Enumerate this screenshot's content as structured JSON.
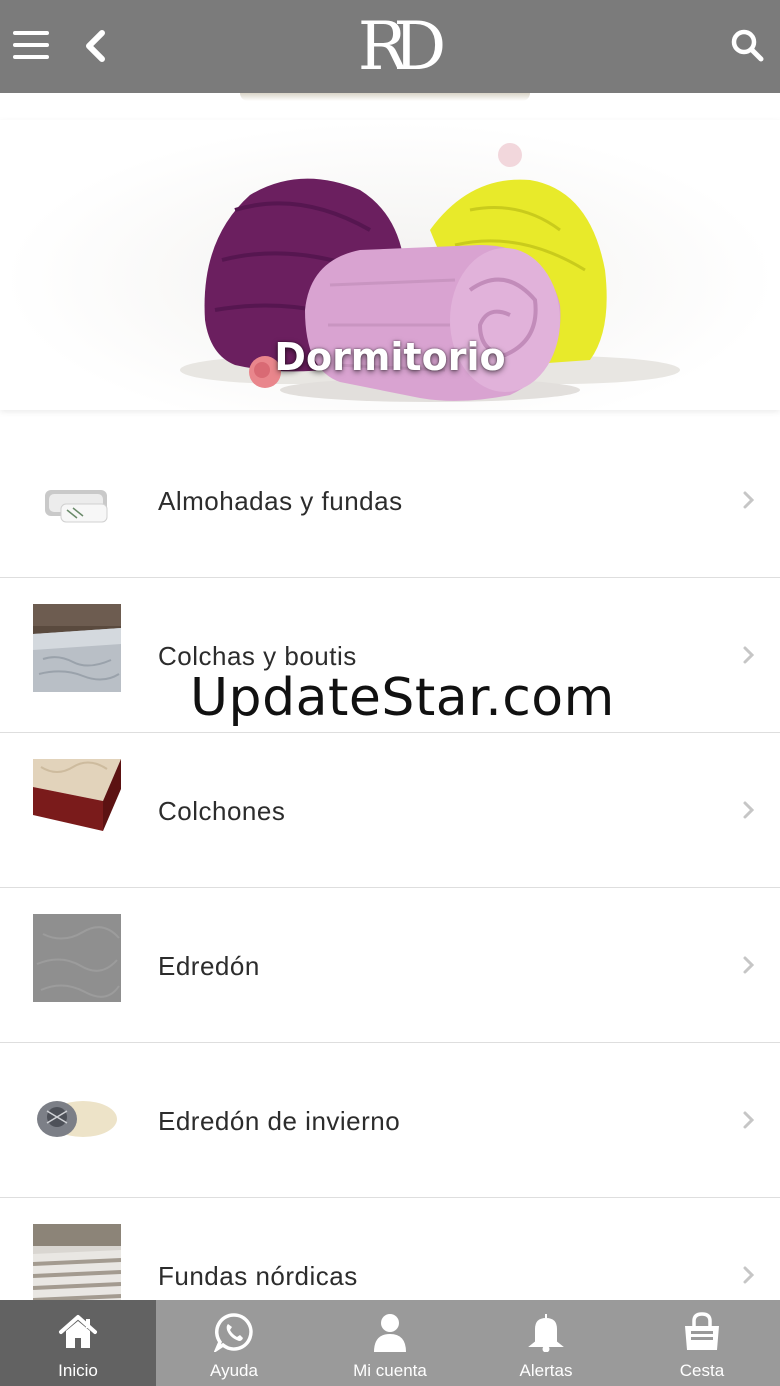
{
  "header": {
    "logo_text": "RD",
    "menu_icon": "hamburger-menu-icon",
    "back_icon": "chevron-left-icon",
    "search_icon": "search-icon",
    "bar_color": "#7b7b7b"
  },
  "hero": {
    "title": "Dormitorio"
  },
  "categories": [
    {
      "label": "Almohadas y fundas",
      "thumb": "pillows-thumbnail"
    },
    {
      "label": "Colchas y boutis",
      "thumb": "bedspread-thumbnail"
    },
    {
      "label": "Colchones",
      "thumb": "mattress-thumbnail"
    },
    {
      "label": "Edredón",
      "thumb": "duvet-thumbnail"
    },
    {
      "label": "Edredón de invierno",
      "thumb": "winter-duvet-thumbnail"
    },
    {
      "label": "Fundas nórdicas",
      "thumb": "duvet-cover-thumbnail"
    }
  ],
  "watermark": "UpdateStar.com",
  "bottom_nav": {
    "items": [
      {
        "label": "Inicio",
        "icon": "home-icon",
        "active": true
      },
      {
        "label": "Ayuda",
        "icon": "whatsapp-icon",
        "active": false
      },
      {
        "label": "Mi cuenta",
        "icon": "user-icon",
        "active": false
      },
      {
        "label": "Alertas",
        "icon": "bell-icon",
        "active": false
      },
      {
        "label": "Cesta",
        "icon": "shopping-bag-icon",
        "active": false
      }
    ],
    "bar_color": "#9a9a9a",
    "active_color": "#626262"
  }
}
